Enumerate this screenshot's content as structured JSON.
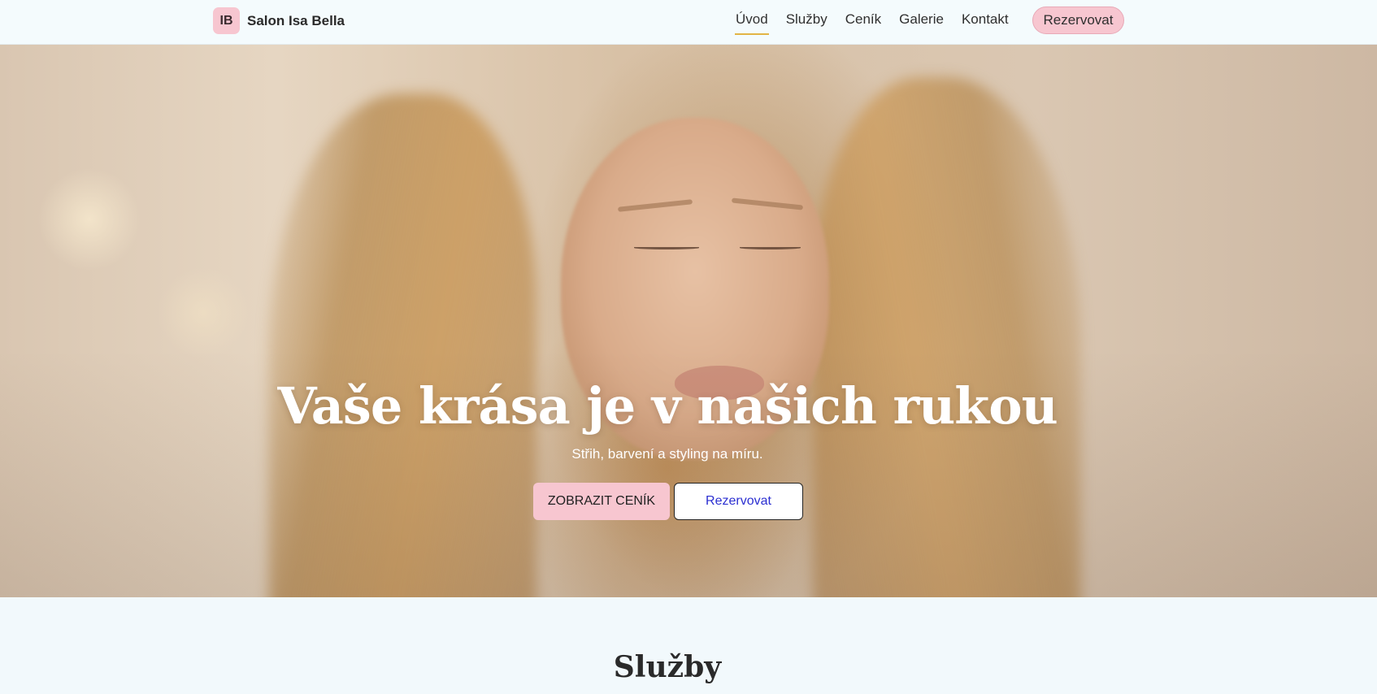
{
  "header": {
    "logo_text": "IB",
    "brand_name": "Salon Isa Bella",
    "nav": [
      {
        "label": "Úvod",
        "active": true
      },
      {
        "label": "Služby"
      },
      {
        "label": "Ceník"
      },
      {
        "label": "Galerie"
      },
      {
        "label": "Kontakt"
      }
    ],
    "cta_label": "Rezervovat"
  },
  "hero": {
    "title": "Vaše krása je v našich rukou",
    "subtitle": "Střih, barvení a styling na míru.",
    "primary_button": "ZOBRAZIT CENÍK",
    "secondary_button": "Rezervovat"
  },
  "services": {
    "title": "Služby"
  },
  "colors": {
    "accent_pink": "#f7c6d0",
    "active_underline": "#e2b445",
    "link_blue": "#2b2fd1",
    "page_bg": "#f2f9fc"
  }
}
